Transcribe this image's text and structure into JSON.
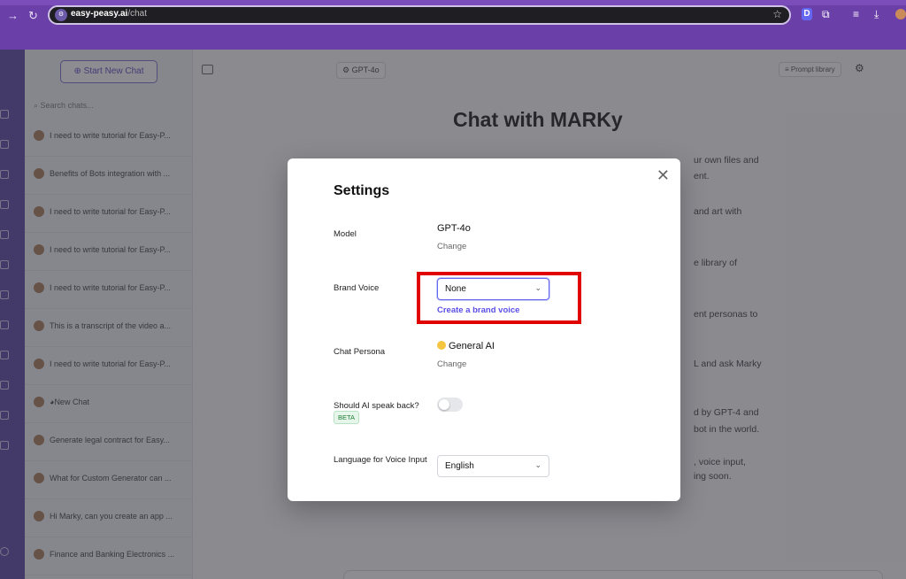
{
  "browser": {
    "url_host": "easy-peasy.ai",
    "url_path": "/chat",
    "extension_d": "D"
  },
  "sidebar": {
    "new_chat_label": "Start New Chat",
    "search_placeholder": "Search chats...",
    "chats": [
      "I need to write tutorial for Easy-P...",
      "Benefits of Bots integration with ...",
      "I need to write tutorial for Easy-P...",
      "I need to write tutorial for Easy-P...",
      "I need to write tutorial for Easy-P...",
      "This is a transcript of the video a...",
      "I need to write tutorial for Easy-P...",
      "New Chat",
      "Generate legal contract for Easy...",
      "What for Custom Generator can ...",
      "Hi Marky, can you create an app ...",
      "Finance and Banking Electronics ..."
    ]
  },
  "main": {
    "model_pill": "GPT-4o",
    "prompt_library": "Prompt library",
    "title": "Chat with MARKy",
    "features": [
      "ur own files and",
      "ent.",
      "and art with",
      "e library of",
      "ent personas to",
      "L and ask Marky",
      "d by GPT-4 and",
      "bot in the world.",
      ", voice input,",
      "ing soon."
    ]
  },
  "settings": {
    "title": "Settings",
    "model_label": "Model",
    "model_value": "GPT-4o",
    "model_change": "Change",
    "brand_voice_label": "Brand Voice",
    "brand_voice_value": "None",
    "brand_voice_link": "Create a brand voice",
    "persona_label": "Chat Persona",
    "persona_value": "General AI",
    "persona_change": "Change",
    "speak_label": "Should AI speak back?",
    "beta": "BETA",
    "speak_enabled": false,
    "voice_lang_label": "Language for Voice Input",
    "voice_lang_value": "English"
  },
  "colors": {
    "accent": "#6366f1",
    "highlight": "#e00000"
  }
}
